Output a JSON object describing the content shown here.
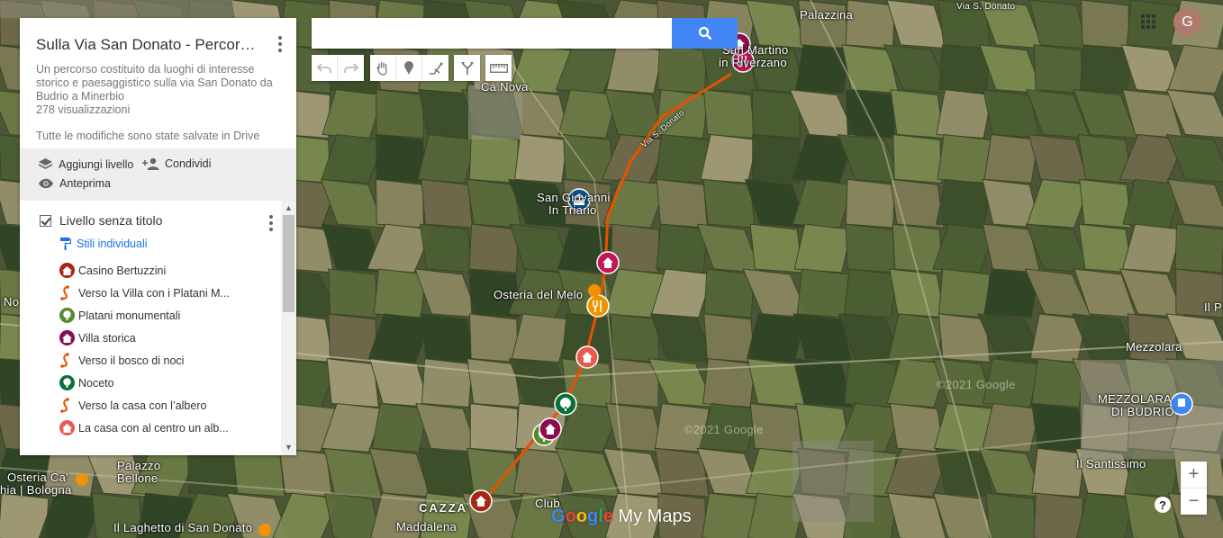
{
  "panel": {
    "title": "Sulla Via San Donato - Percorso ...",
    "description": "Un percorso costituito da luoghi di interesse storico e paesaggistico sulla via San Donato da Budrio a Minerbio",
    "views": "278 visualizzazioni",
    "save_status": "Tutte le modifiche sono state salvate in Drive",
    "actions": {
      "add_layer": "Aggiungi livello",
      "share": "Condividi",
      "preview": "Anteprima"
    },
    "layer": {
      "title": "Livello senza titolo",
      "styles_link": "Stili individuali",
      "items": [
        {
          "label": "Casino Bertuzzini",
          "icon": "home-icon",
          "color": "#a52714"
        },
        {
          "label": "Verso la Villa con i Platani M...",
          "icon": "route-icon",
          "color": "#e65100"
        },
        {
          "label": "Platani monumentali",
          "icon": "tree-icon",
          "color": "#558b2f"
        },
        {
          "label": "Villa storica",
          "icon": "home-icon",
          "color": "#880e4f"
        },
        {
          "label": "Verso il bosco di noci",
          "icon": "route-icon",
          "color": "#e65100"
        },
        {
          "label": "Noceto",
          "icon": "tree-icon",
          "color": "#097138"
        },
        {
          "label": "Verso la casa con l’albero",
          "icon": "route-icon",
          "color": "#e65100"
        },
        {
          "label": "La casa con al centro un alb...",
          "icon": "home-icon",
          "color": "#e75a4d"
        }
      ]
    }
  },
  "search": {
    "placeholder": "",
    "value": ""
  },
  "account": {
    "initial": "G"
  },
  "zoom": {
    "in": "+",
    "out": "−"
  },
  "help": "?",
  "logo": {
    "google": "Google",
    "mymaps": " My Maps"
  },
  "map_labels": {
    "palazzina": "Palazzina",
    "via_s_donato_top": "Via S. Donato",
    "san_martino_1": "San Martino",
    "san_martino_2": "in Riverzano",
    "ca_nova": "Cà Nova",
    "via_s_donato_road": "Via S. Donato",
    "san_giovanni_1": "San Giovanni",
    "san_giovanni_2": "In Triario",
    "osteria_melo": "Osteria del Melo",
    "mezzolara": "Mezzolara",
    "mezzolara_budrio_1": "MEZZOLARA",
    "mezzolara_budrio_2": "DI BUDRIO",
    "santissimo": "Il Santissimo",
    "osteria_ca_1": "Osteria Ca'",
    "osteria_ca_2": "hia | Bologna",
    "palazzo_1": "Palazzo",
    "palazzo_2": "Bellone",
    "cazza": "CAZZA",
    "club": "Club",
    "maddalena": "Maddalena",
    "laghetto": "Il Laghetto di San Donato",
    "no": "No",
    "il": "Il P",
    "copyright1": "©2021 Google",
    "copyright2": "©2021 Google"
  },
  "colors": {
    "route": "#e65100",
    "search_button": "#4285f4"
  }
}
